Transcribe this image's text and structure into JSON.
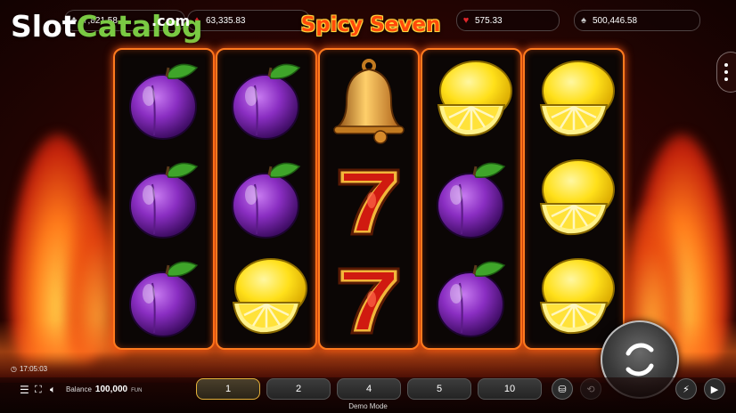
{
  "header": {
    "watermark_part1": "Slot",
    "watermark_part2": "Catalog",
    "watermark_part3": ".com",
    "game_title": "Spicy Seven",
    "jackpots": [
      {
        "icon": "clubs-icon",
        "value": "7,821.58"
      },
      {
        "icon": "diamond-icon",
        "value": "63,335.83"
      },
      {
        "icon": "heart-icon",
        "value": "575.33"
      },
      {
        "icon": "spade-icon",
        "value": "500,446.58"
      }
    ]
  },
  "reels": [
    [
      "plum",
      "plum",
      "plum"
    ],
    [
      "plum",
      "plum",
      "lemon"
    ],
    [
      "bell",
      "seven",
      "seven"
    ],
    [
      "lemon",
      "plum",
      "plum"
    ],
    [
      "lemon",
      "lemon",
      "lemon"
    ]
  ],
  "footer": {
    "clock": "17:05:03",
    "balance_label": "Balance",
    "balance_value": "100,000",
    "balance_currency": "FUN",
    "bets": [
      "1",
      "2",
      "4",
      "5",
      "10"
    ],
    "selected_bet": "1",
    "mode_label": "Demo Mode"
  },
  "colors": {
    "reel_border": "#ff7a1e",
    "plum": "#8a2ec2",
    "lemon": "#ffe01a",
    "seven": "#d01a10",
    "bell": "#e8a33a"
  }
}
